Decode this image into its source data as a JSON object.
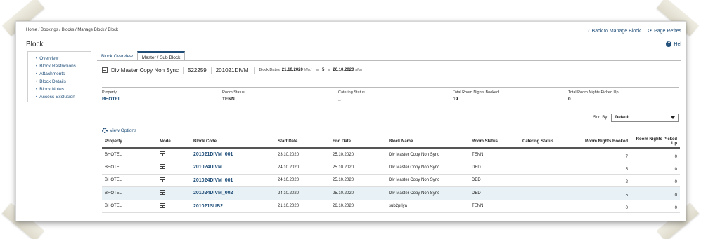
{
  "breadcrumb": "Home / Bookings / Blocks / Manage Block / Block",
  "top_links": {
    "back": "Back to Manage Block",
    "refresh": "Page Refres"
  },
  "page_title": "Block",
  "help": "Hel",
  "sidebar": {
    "items": [
      {
        "label": "Overview"
      },
      {
        "label": "Block Restrictions"
      },
      {
        "label": "Attachments"
      },
      {
        "label": "Block Details"
      },
      {
        "label": "Block Notes"
      },
      {
        "label": "Access Exclusion"
      }
    ]
  },
  "tabs": [
    {
      "label": "Block Overview",
      "active": false
    },
    {
      "label": "Master / Sub Block",
      "active": true
    }
  ],
  "block": {
    "name": "Div Master Copy Non Sync",
    "id": "522259",
    "code": "201021DIVM",
    "dates_label": "Block Dates",
    "start": "21.10.2020",
    "start_dow": "Wed",
    "nights": "5",
    "end": "26.10.2020",
    "end_dow": "Mon"
  },
  "summary": {
    "property_label": "Property",
    "property": "BHOTEL",
    "room_status_label": "Room Status",
    "room_status": "TENN",
    "catering_status_label": "Catering Status",
    "catering_status": "_",
    "booked_label": "Total Room Nights Booked",
    "booked": "19",
    "picked_label": "Total Room Nights Picked Up",
    "picked": "0"
  },
  "sort": {
    "label": "Sort By:",
    "value": "Default"
  },
  "view_options": "View Options",
  "table": {
    "headers": {
      "property": "Property",
      "mode": "Mode",
      "code": "Block Code",
      "start": "Start Date",
      "end": "End Date",
      "name": "Block Name",
      "room_status": "Room Status",
      "catering_status": "Catering Status",
      "booked": "Room Nights Booked",
      "picked": "Room Nights Picked Up"
    },
    "rows": [
      {
        "property": "BHOTEL",
        "code": "201021DIVM_001",
        "start": "23.10.2020",
        "end": "25.10.2020",
        "name": "Div Master Copy Non Sync",
        "room_status": "TENN",
        "booked": "7",
        "picked": "0"
      },
      {
        "property": "BHOTEL",
        "code": "201024DIVM",
        "start": "24.10.2020",
        "end": "25.10.2020",
        "name": "Div Master Copy Non Sync",
        "room_status": "DED",
        "booked": "5",
        "picked": "0"
      },
      {
        "property": "BHOTEL",
        "code": "201024DIVM_001",
        "start": "24.10.2020",
        "end": "25.10.2020",
        "name": "Div Master Copy Non Sync",
        "room_status": "DED",
        "booked": "2",
        "picked": "0"
      },
      {
        "property": "BHOTEL",
        "code": "201024DIVM_002",
        "start": "24.10.2020",
        "end": "25.10.2020",
        "name": "Div Master Copy Non Sync",
        "room_status": "DED",
        "booked": "5",
        "picked": "0"
      },
      {
        "property": "BHOTEL",
        "code": "201021SUB2",
        "start": "21.10.2020",
        "end": "26.10.2020",
        "name": "sub2priya",
        "room_status": "TENN",
        "booked": "0",
        "picked": "0"
      }
    ]
  },
  "colors": {
    "link": "#1f4e79",
    "selected_row": "#e8f1f5"
  }
}
